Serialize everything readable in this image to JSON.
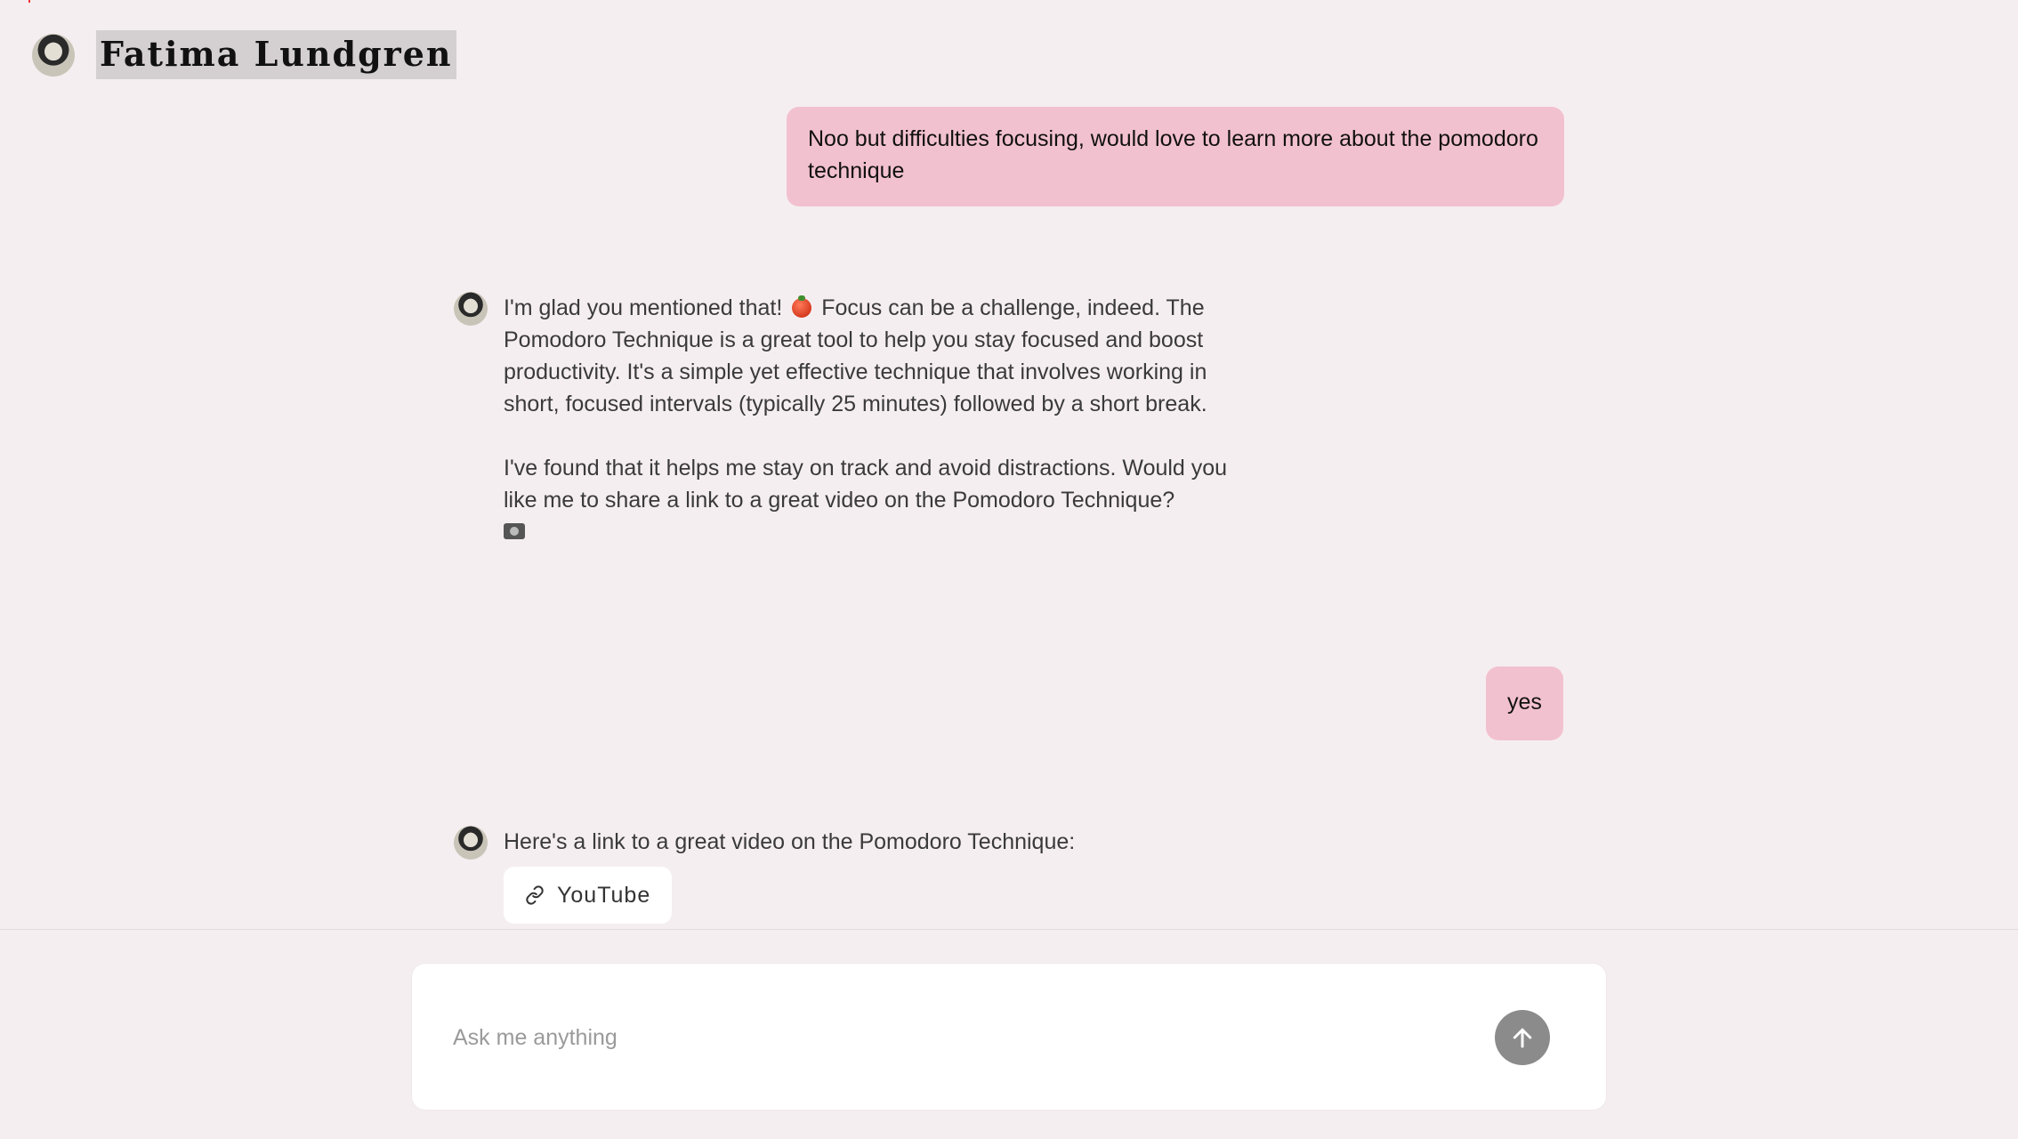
{
  "header": {
    "name": "Fatima Lundgren"
  },
  "messages": {
    "user1": "Noo but difficulties focusing, would love to learn more about the pomodoro technique",
    "bot1_p1_before": "I'm glad you mentioned that!",
    "bot1_p1_after": "Focus can be a challenge, indeed. The Pomodoro Technique is a great tool to help you stay focused and boost productivity. It's a simple yet effective technique that involves working in short, focused intervals (typically 25 minutes) followed by a short break.",
    "bot1_p2": "I've found that it helps me stay on track and avoid distractions. Would you like me to share a link to a great video on the Pomodoro Technique?",
    "user2": "yes",
    "bot2": "Here's a link to a great video on the Pomodoro Technique:",
    "link_label": "YouTube"
  },
  "composer": {
    "placeholder": "Ask me anything",
    "value": ""
  },
  "icons": {
    "avatar": "avatar",
    "tomato": "tomato-emoji-icon",
    "camera": "video-camera-emoji-icon",
    "link": "link-icon",
    "send": "arrow-up-icon"
  },
  "colors": {
    "background": "#f5eef0",
    "user_bubble": "#f2c1cf",
    "send_button": "#8b8b8b"
  }
}
